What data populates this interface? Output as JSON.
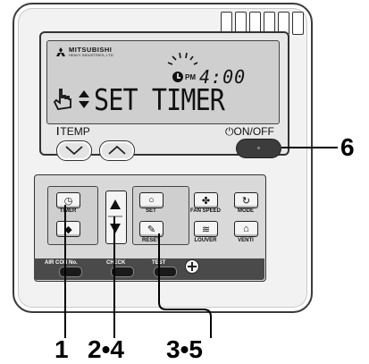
{
  "lcd": {
    "brand": "MITSUBISHI",
    "brand_sub": "HEAVY INDUSTRIES, LTD.",
    "pm": "PM",
    "time": "4:00",
    "message": "SET TIMER",
    "icons": [
      "hand-pointer-icon",
      "up-down-arrows-icon",
      "clock-icon"
    ]
  },
  "labels": {
    "temp": "TEMP",
    "onoff": "ON/OFF"
  },
  "keys": {
    "timer": "TIMER",
    "set": "SET",
    "reset": "RESET",
    "fan_speed": "FAN SPEED",
    "mode": "MODE",
    "louver": "LOUVER",
    "venti": "VENTI"
  },
  "bottom": {
    "aircon_no": "AIR CON No.",
    "check": "CHECK",
    "test": "TEST"
  },
  "callouts": {
    "c1": "1",
    "c2": "2•4",
    "c3": "3•5",
    "c6": "6"
  },
  "colors": {
    "body": "#f2f2f2",
    "lcd": "#cfcfcf",
    "onoff": "#3c3c3c",
    "ink": "#111111"
  }
}
